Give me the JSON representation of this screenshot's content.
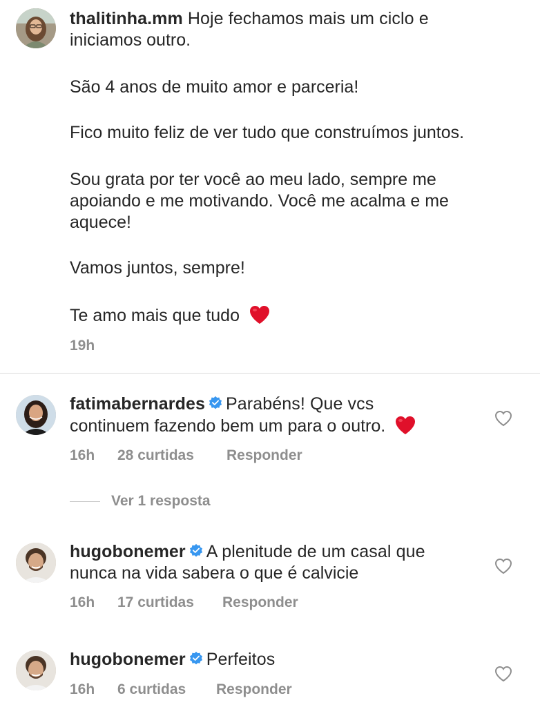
{
  "caption": {
    "username": "thalitinha.mm",
    "first_line": "Hoje fechamos mais um ciclo e",
    "first_line_cont": "iniciamos outro.",
    "p2": "São 4 anos de muito amor e parceria!",
    "p3": "Fico muito feliz de ver tudo que construímos juntos.",
    "p4_l1": "Sou grata por ter você ao meu lado, sempre me",
    "p4_l2": "apoiando e me motivando. Você me acalma e me",
    "p4_l3": "aquece!",
    "p5": "Vamos juntos, sempre!",
    "p6": "Te amo mais que tudo",
    "time": "19h"
  },
  "comments": [
    {
      "username": "fatimabernardes",
      "text_l1": "Parabéns! Que vcs",
      "text_l2": "continuem fazendo bem um para o outro.",
      "time": "16h",
      "likes": "28 curtidas",
      "reply": "Responder",
      "view_replies": "Ver 1 resposta"
    },
    {
      "username": "hugobonemer",
      "text_l1": "A plenitude de um casal que",
      "text_l2": "nunca na vida sabera o que é calvicie",
      "time": "16h",
      "likes": "17 curtidas",
      "reply": "Responder"
    },
    {
      "username": "hugobonemer",
      "text_l1": "Perfeitos",
      "time": "16h",
      "likes": "6 curtidas",
      "reply": "Responder"
    }
  ],
  "icons": {
    "verified": "verified-badge-icon",
    "like": "heart-outline-icon",
    "emoji": "red-heart-emoji"
  },
  "colors": {
    "text": "#262626",
    "meta": "#8e8e8e",
    "verified": "#3897f0",
    "heart": "#e0102a"
  }
}
